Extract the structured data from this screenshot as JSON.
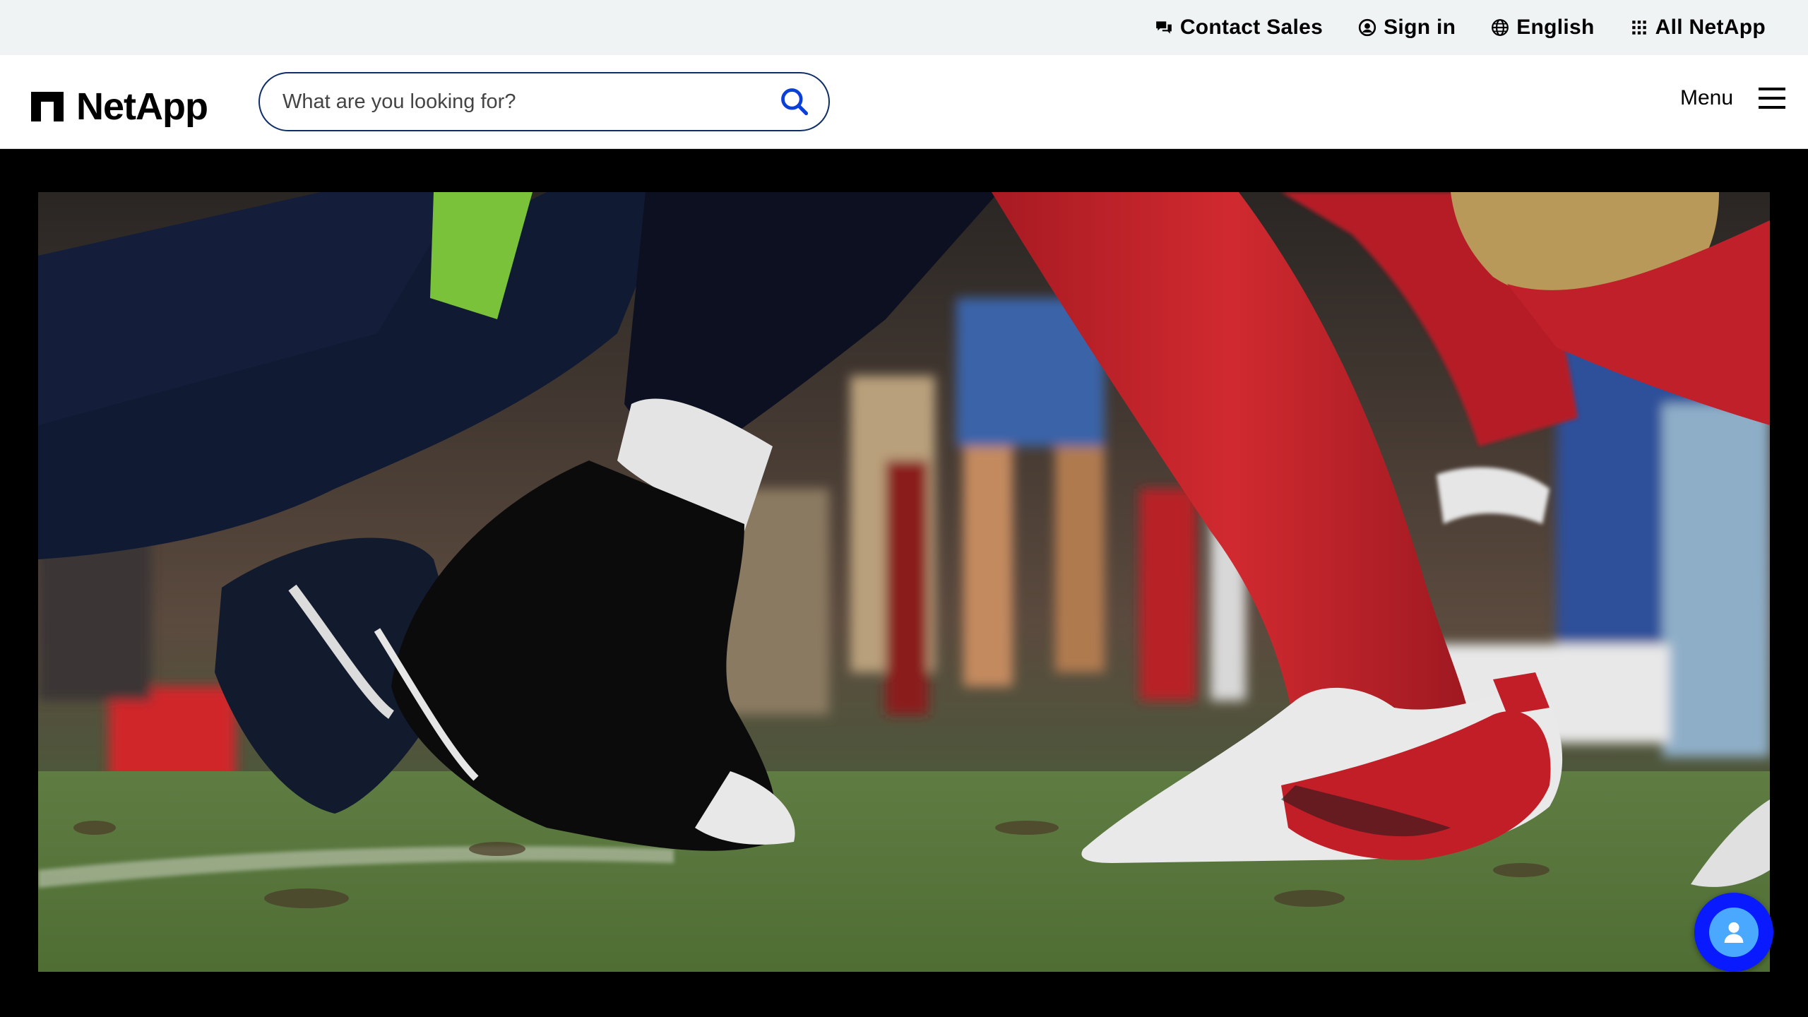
{
  "utility_bar": {
    "contact_sales": "Contact Sales",
    "sign_in": "Sign in",
    "language": "English",
    "all_products": "All NetApp"
  },
  "header": {
    "logo_text": "NetApp",
    "search_placeholder": "What are you looking for?",
    "menu_label": "Menu"
  },
  "hero": {
    "media": "video-still-football-cleats"
  },
  "icons": {
    "contact_sales": "chat-bubbles-icon",
    "sign_in": "user-circle-icon",
    "language": "globe-icon",
    "all_products": "grid-icon",
    "search": "search-icon",
    "menu": "hamburger-icon",
    "chat": "chat-assistant-icon"
  },
  "colors": {
    "utility_bg": "#eff3f3",
    "search_border": "#0f2e66",
    "search_icon": "#0a3fd8",
    "chat_button": "#0a1aff"
  }
}
